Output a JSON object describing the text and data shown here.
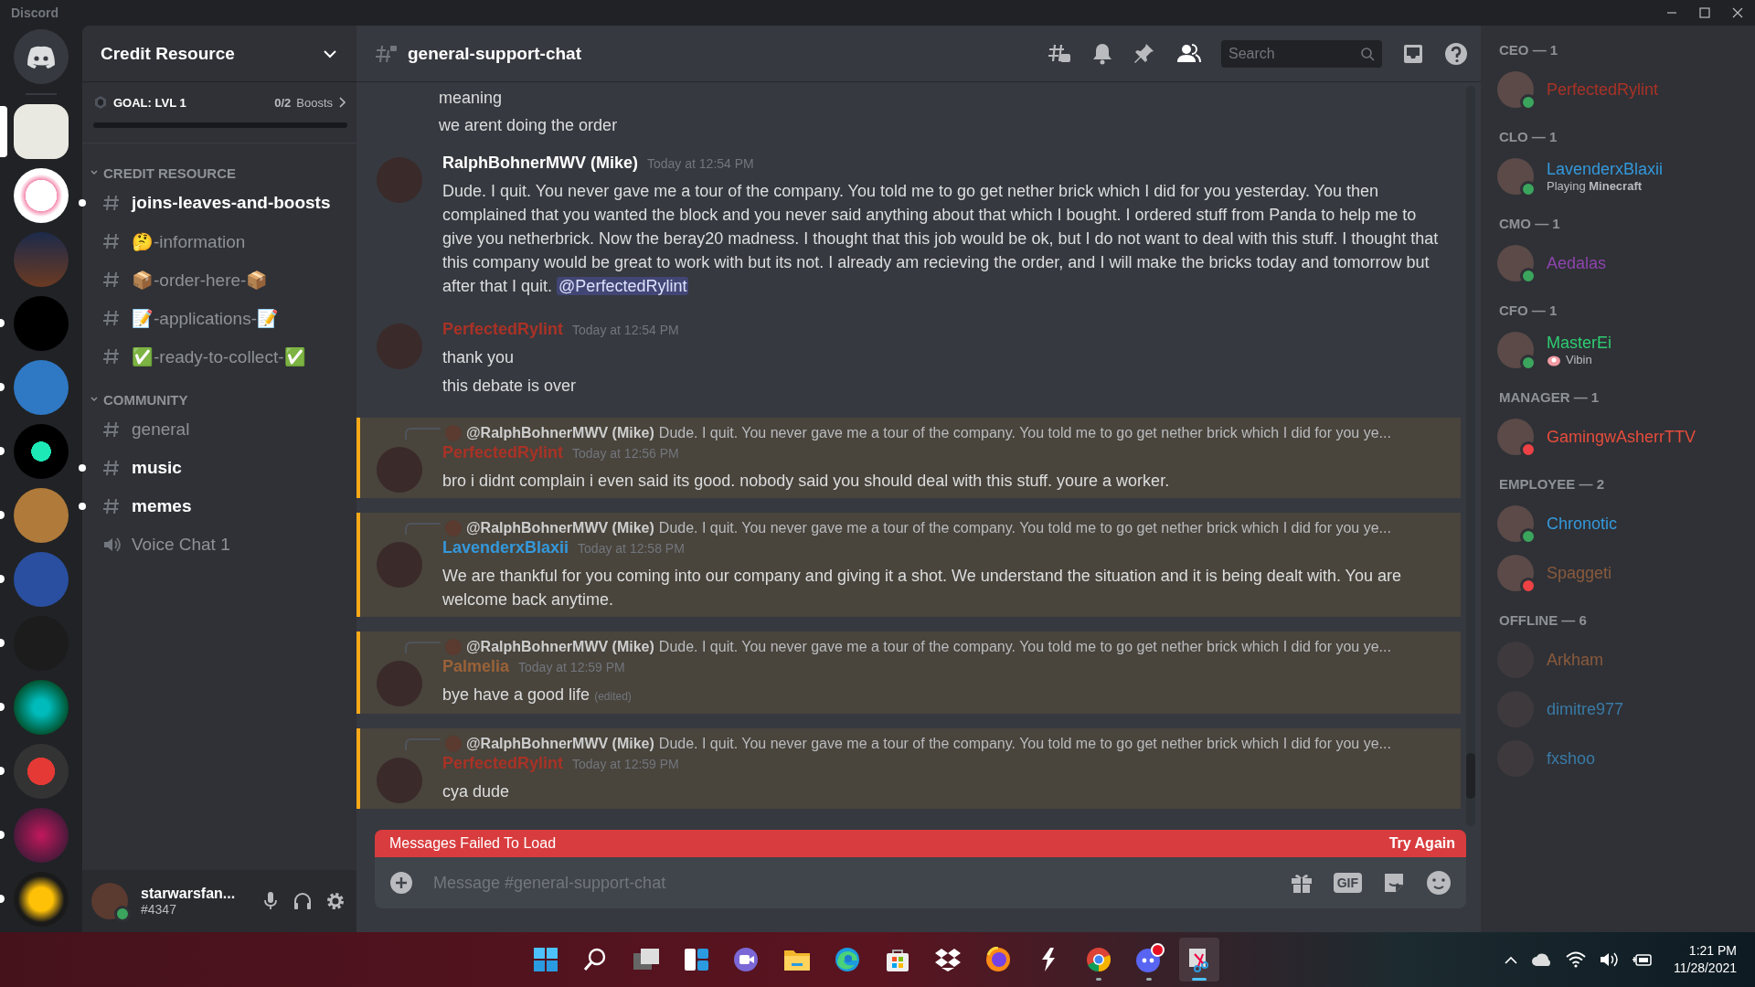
{
  "window": {
    "title": "Discord"
  },
  "servers": [
    {
      "selected": false,
      "unread": false
    },
    {
      "selected": true,
      "unread": false
    },
    {
      "selected": false,
      "unread": false
    },
    {
      "selected": false,
      "unread": false
    },
    {
      "selected": false,
      "unread": true
    },
    {
      "selected": false,
      "unread": true
    },
    {
      "selected": false,
      "unread": true
    },
    {
      "selected": false,
      "unread": true
    },
    {
      "selected": false,
      "unread": true
    },
    {
      "selected": false,
      "unread": true
    },
    {
      "selected": false,
      "unread": true
    },
    {
      "selected": false,
      "unread": true
    },
    {
      "selected": false,
      "unread": true
    },
    {
      "selected": false,
      "unread": true
    }
  ],
  "sidebar": {
    "server_name": "Credit Resource",
    "boost": {
      "goal": "GOAL: LVL 1",
      "count": "0/2",
      "unit": "Boosts",
      "level": 0
    },
    "categories": [
      {
        "name": "CREDIT RESOURCE",
        "expanded": true,
        "channels": [
          {
            "name": "joins-leaves-and-boosts",
            "kind": "text",
            "unread": true
          },
          {
            "name": "🤔-information",
            "kind": "text",
            "unread": false
          },
          {
            "name": "📦-order-here-📦",
            "kind": "text",
            "unread": false
          },
          {
            "name": "📝-applications-📝",
            "kind": "text",
            "unread": false
          },
          {
            "name": "✅-ready-to-collect-✅",
            "kind": "text",
            "unread": false
          }
        ]
      },
      {
        "name": "COMMUNITY",
        "expanded": true,
        "channels": [
          {
            "name": "general",
            "kind": "text",
            "unread": false
          },
          {
            "name": "music",
            "kind": "text",
            "unread": true
          },
          {
            "name": "memes",
            "kind": "text",
            "unread": true
          },
          {
            "name": "Voice Chat 1",
            "kind": "voice",
            "unread": false
          }
        ]
      }
    ],
    "user": {
      "name": "starwarsfan...",
      "tag": "#4347",
      "kind": "online"
    }
  },
  "chat": {
    "channel": "general-support-chat",
    "search_placeholder": "Search",
    "messages": [
      {
        "kind": "continuation",
        "lines": [
          "meaning",
          "we arent doing the order"
        ]
      },
      {
        "kind": "message",
        "author": "RalphBohnerMWV (Mike)",
        "color": "#ffffff",
        "time": "Today at 12:54 PM",
        "highlighted": false,
        "lines": [
          "Dude. I quit. You never gave me a tour of the company. You told me to go get nether brick which I did for you yesterday. You then complained that you wanted the block and you never said anything about that which I bought. I ordered stuff from Panda to help me to give you netherbrick. Now the beray20 madness. I thought that this job would be ok, but I do not want to deal with this stuff. I thought that this company would be great to work with but its not. I already am recieving the order, and I will make the bricks today and tomorrow but after that I quit."
        ],
        "mention": "@PerfectedRylint"
      },
      {
        "kind": "message",
        "author": "PerfectedRylint",
        "color": "#a93226",
        "time": "Today at 12:54 PM",
        "highlighted": false,
        "lines": [
          "thank you",
          "this debate is over"
        ]
      },
      {
        "kind": "message",
        "author": "PerfectedRylint",
        "color": "#a93226",
        "time": "Today at 12:56 PM",
        "highlighted": true,
        "reply": {
          "author": "@RalphBohnerMWV (Mike)",
          "text": "Dude. I quit. You never gave me a tour of the company. You told me to go get nether brick which I did for you ye..."
        },
        "lines": [
          "bro i didnt complain i even said its good. nobody said you should deal with this stuff. youre a worker."
        ]
      },
      {
        "kind": "message",
        "author": "LavenderxBlaxii",
        "color": "#3498db",
        "time": "Today at 12:58 PM",
        "highlighted": true,
        "reply": {
          "author": "@RalphBohnerMWV (Mike)",
          "text": "Dude. I quit. You never gave me a tour of the company. You told me to go get nether brick which I did for you ye..."
        },
        "lines": [
          "We are thankful for you coming into our company and giving it a shot. We understand the situation and it is being dealt with. You are welcome back anytime."
        ]
      },
      {
        "kind": "message",
        "author": "Palmelia",
        "color": "#9a6238",
        "time": "Today at 12:59 PM",
        "highlighted": true,
        "reply": {
          "author": "@RalphBohnerMWV (Mike)",
          "text": "Dude. I quit. You never gave me a tour of the company. You told me to go get nether brick which I did for you ye..."
        },
        "lines": [
          "bye have a good life"
        ],
        "edited": "(edited)"
      },
      {
        "kind": "message",
        "author": "PerfectedRylint",
        "color": "#a93226",
        "time": "Today at 12:59 PM",
        "highlighted": true,
        "reply": {
          "author": "@RalphBohnerMWV (Mike)",
          "text": "Dude. I quit. You never gave me a tour of the company. You told me to go get nether brick which I did for you ye..."
        },
        "lines": [
          "cya dude"
        ]
      }
    ],
    "error": {
      "text": "Messages Failed To Load",
      "action": "Try Again"
    },
    "composer": {
      "placeholder": "Message #general-support-chat",
      "gif": "GIF"
    }
  },
  "members": [
    {
      "role": "CEO — 1",
      "members": [
        {
          "name": "PerfectedRylint",
          "color": "#a93226",
          "kind": "online"
        }
      ]
    },
    {
      "role": "CLO — 1",
      "members": [
        {
          "name": "LavenderxBlaxii",
          "color": "#3498db",
          "kind": "online",
          "activity": "Playing **Minecraft**"
        }
      ]
    },
    {
      "role": "CMO — 1",
      "members": [
        {
          "name": "Aedalas",
          "color": "#8e44ad",
          "kind": "online"
        }
      ]
    },
    {
      "role": "CFO — 1",
      "members": [
        {
          "name": "MasterEi",
          "color": "#2ecc71",
          "kind": "online",
          "activity": "Vibin",
          "activity_emoji": true
        }
      ]
    },
    {
      "role": "MANAGER — 1",
      "members": [
        {
          "name": "GamingwAsherrTTV",
          "color": "#e74c3c",
          "kind": "dnd"
        }
      ]
    },
    {
      "role": "EMPLOYEE — 2",
      "members": [
        {
          "name": "Chronotic",
          "color": "#3498db",
          "kind": "online"
        },
        {
          "name": "Spaggeti",
          "color": "#8a5a3c",
          "kind": "dnd"
        }
      ]
    },
    {
      "role": "OFFLINE — 6",
      "members": [
        {
          "name": "Arkham",
          "color": "#8a5a3c",
          "kind": "offline"
        },
        {
          "name": "dimitre977",
          "color": "#3a7aa6",
          "kind": "offline"
        },
        {
          "name": "fxshoo",
          "color": "#3a7aa6",
          "kind": "offline"
        }
      ]
    }
  ],
  "taskbar": {
    "apps": [
      {
        "kind": "start",
        "running": false,
        "active": false
      },
      {
        "kind": "search",
        "running": false,
        "active": false
      },
      {
        "kind": "taskview",
        "running": false,
        "active": false
      },
      {
        "kind": "widgets",
        "running": false,
        "active": false
      },
      {
        "kind": "meet",
        "running": false,
        "active": false
      },
      {
        "kind": "folder",
        "running": false,
        "active": false
      },
      {
        "kind": "edge",
        "running": false,
        "active": false
      },
      {
        "kind": "store",
        "running": false,
        "active": false
      },
      {
        "kind": "box",
        "running": false,
        "active": false
      },
      {
        "kind": "fox",
        "running": false,
        "active": false
      },
      {
        "kind": "bolt",
        "running": false,
        "active": false
      },
      {
        "kind": "chrome",
        "running": true,
        "active": false
      },
      {
        "kind": "discord",
        "running": true,
        "active": false,
        "notified": true
      },
      {
        "kind": "snip",
        "running": true,
        "active": true
      }
    ],
    "time": "1:21 PM",
    "date": "11/28/2021"
  }
}
